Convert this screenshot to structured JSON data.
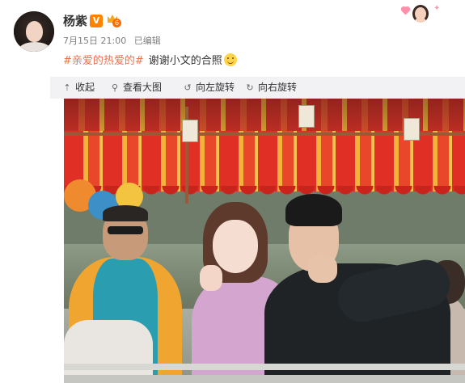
{
  "post": {
    "user_name": "杨紫",
    "verified_badge": "V",
    "vip_level": "6",
    "date": "7月15日 21:00",
    "edited": "已编辑",
    "hashtag": "#亲爱的热爱的#",
    "text": "谢谢小文的合照"
  },
  "toolbar": {
    "collapse_label": "收起",
    "view_large_label": "查看大图",
    "rotate_left_label": "向左旋转",
    "rotate_right_label": "向右旋转"
  },
  "icons": {
    "collapse": "arrow-up-icon",
    "view_large": "magnifier-icon",
    "rotate_left": "rotate-left-icon",
    "rotate_right": "rotate-right-icon",
    "emoji": "smile-emoji",
    "verified": "verified-v-icon",
    "vip": "vip-crown-icon"
  },
  "colors": {
    "hashtag": "#eb7350",
    "verified": "#ff8200",
    "toolbar_bg": "#f2f2f5",
    "meta_text": "#808080"
  }
}
